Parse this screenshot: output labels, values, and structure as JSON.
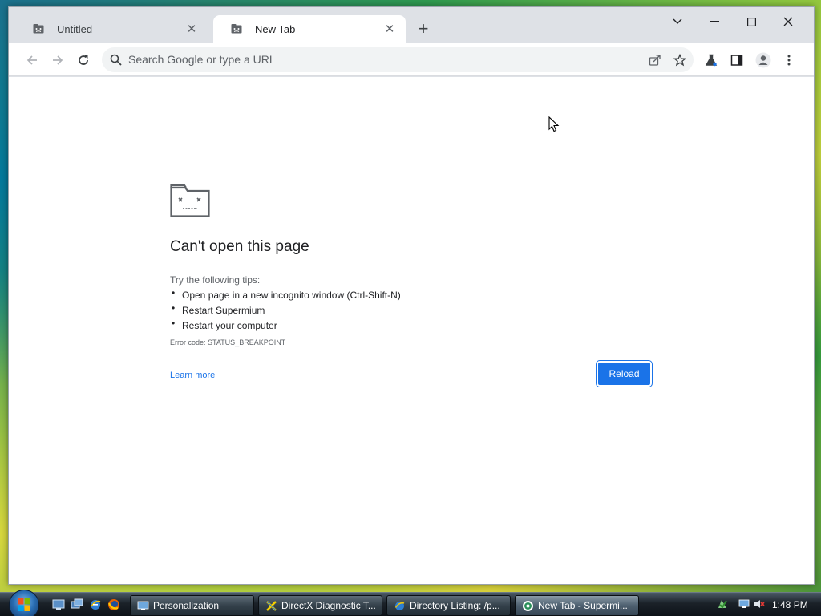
{
  "browser": {
    "tabs": [
      {
        "title": "Untitled",
        "close_symbol": "✕",
        "icon": "page-icon",
        "active": false
      },
      {
        "title": "New Tab",
        "close_symbol": "✕",
        "icon": "page-icon",
        "active": true
      }
    ],
    "new_tab_symbol": "+",
    "omnibox": {
      "placeholder": "Search Google or type a URL",
      "value": ""
    },
    "toolbar_icons": [
      "back-icon",
      "forward-icon",
      "reload-icon",
      "share-icon",
      "star-icon",
      "labs-icon",
      "side-panel-icon",
      "profile-icon",
      "menu-icon"
    ],
    "window_controls": [
      "tab-search-icon",
      "minimize-icon",
      "maximize-icon",
      "close-icon"
    ]
  },
  "error_page": {
    "title": "Can't open this page",
    "tips_heading": "Try the following tips:",
    "tips": [
      "Open page in a new incognito window (Ctrl-Shift-N)",
      "Restart Supermium",
      "Restart your computer"
    ],
    "bullet": "•",
    "error_code": "Error code: STATUS_BREAKPOINT",
    "learn_more": "Learn more",
    "reload_label": "Reload",
    "accent_color": "#1a73e8"
  },
  "taskbar": {
    "quick_launch_icons": [
      "show-desktop-icon",
      "switch-windows-icon",
      "internet-explorer-icon",
      "firefox-icon"
    ],
    "buttons": [
      {
        "label": "Personalization",
        "icon": "personalization-icon",
        "active": false
      },
      {
        "label": "DirectX Diagnostic T...",
        "icon": "directx-icon",
        "active": false
      },
      {
        "label": "Directory Listing: /p...",
        "icon": "internet-explorer-icon",
        "active": false
      },
      {
        "label": "New Tab - Supermi...",
        "icon": "supermium-icon",
        "active": true
      }
    ],
    "clock": "1:48 PM"
  }
}
